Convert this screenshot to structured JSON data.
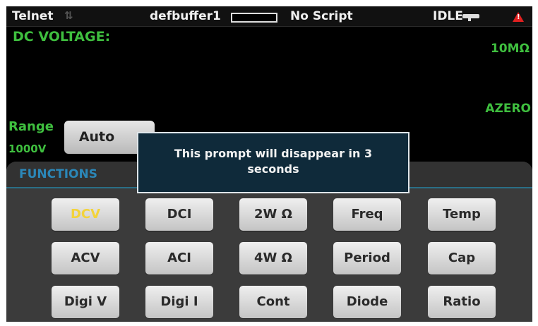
{
  "status_bar": {
    "connection": "Telnet",
    "buffer": "defbuffer1",
    "script": "No Script",
    "state": "IDLE",
    "warning_icon": "warning-triangle-icon"
  },
  "measurement": {
    "function_label": "DC VOLTAGE:",
    "input_impedance": "10MΩ",
    "autozero": "AZERO",
    "range_label": "Range",
    "range_value": "1000V",
    "range_button": "Auto"
  },
  "prompt": {
    "message_line1": "This prompt will disappear in 3",
    "message_line2": "seconds"
  },
  "functions": {
    "title": "FUNCTIONS",
    "buttons": [
      {
        "label": "DCV",
        "active": true
      },
      {
        "label": "DCI"
      },
      {
        "label": "2W Ω"
      },
      {
        "label": "Freq"
      },
      {
        "label": "Temp"
      },
      {
        "label": "ACV"
      },
      {
        "label": "ACI"
      },
      {
        "label": "4W Ω"
      },
      {
        "label": "Period"
      },
      {
        "label": "Cap"
      },
      {
        "label": "Digi V"
      },
      {
        "label": "Digi I"
      },
      {
        "label": "Cont"
      },
      {
        "label": "Diode"
      },
      {
        "label": "Ratio"
      }
    ]
  },
  "colors": {
    "measurement_text": "#3fbf3f",
    "functions_title": "#2b87b8",
    "active_function": "#f3d33a",
    "warning": "#e02020"
  }
}
